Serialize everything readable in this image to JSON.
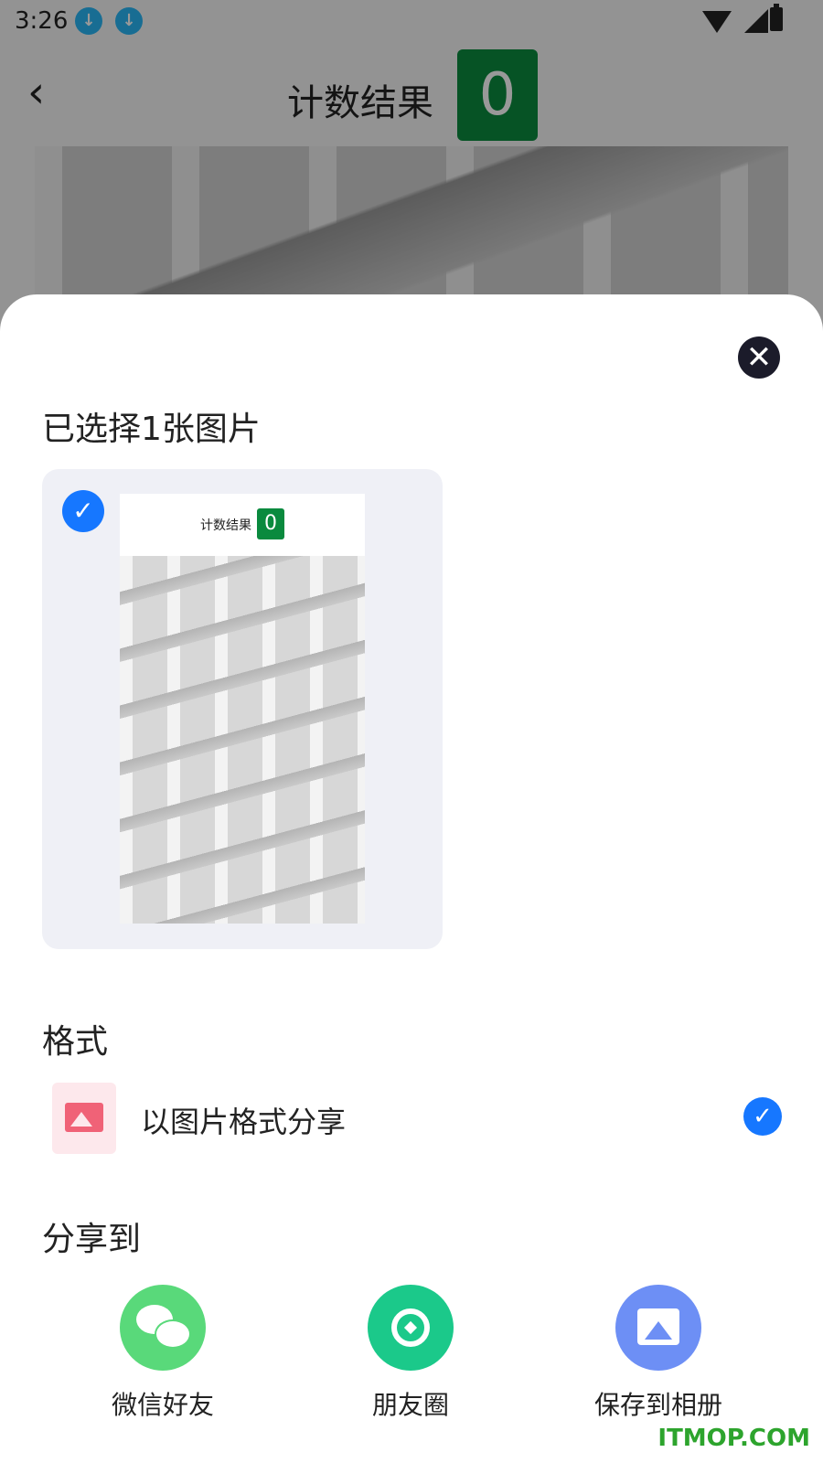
{
  "status_bar": {
    "time": "3:26",
    "download_icon": "↓"
  },
  "header": {
    "title": "计数结果",
    "count": "0",
    "back_icon": "‹"
  },
  "sheet": {
    "close_icon": "✕",
    "selected_heading": "已选择1张图片",
    "preview": {
      "title": "计数结果",
      "count": "0",
      "check": "✓"
    },
    "format_heading": "格式",
    "format_option": {
      "label": "以图片格式分享",
      "check": "✓"
    },
    "share_heading": "分享到",
    "share_targets": [
      {
        "label": "微信好友",
        "icon": "wechat-icon",
        "color": "#59d97a"
      },
      {
        "label": "朋友圈",
        "icon": "moments-icon",
        "color": "#1bc98a"
      },
      {
        "label": "保存到相册",
        "icon": "album-icon",
        "color": "#6d8ff5"
      }
    ]
  },
  "watermark": "ITMOP.COM",
  "colors": {
    "accent_blue": "#1677ff",
    "count_green": "#0a8a3e"
  }
}
